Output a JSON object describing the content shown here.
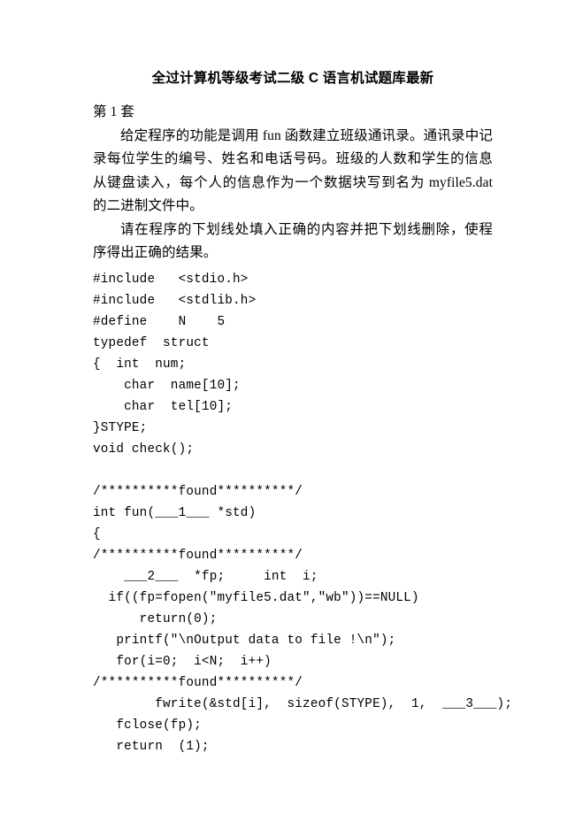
{
  "document": {
    "title": "全过计算机等级考试二级 C 语言机试题库最新",
    "section_label": "第 1 套",
    "paragraphs": [
      "给定程序的功能是调用 fun 函数建立班级通讯录。通讯录中记录每位学生的编号、姓名和电话号码。班级的人数和学生的信息从键盘读入，每个人的信息作为一个数据块写到名为 myfile5.dat 的二进制文件中。",
      "请在程序的下划线处填入正确的内容并把下划线删除，使程序得出正确的结果。"
    ],
    "code_lines": [
      "#include   <stdio.h>",
      "#include   <stdlib.h>",
      "#define    N    5",
      "typedef  struct",
      "{  int  num;",
      "    char  name[10];",
      "    char  tel[10];",
      "}STYPE;",
      "void check();",
      "",
      "/**********found**********/",
      "int fun(___1___ *std)",
      "{",
      "/**********found**********/",
      "    ___2___  *fp;     int  i;",
      "  if((fp=fopen(\"myfile5.dat\",\"wb\"))==NULL)",
      "      return(0);",
      "   printf(\"\\nOutput data to file !\\n\");",
      "   for(i=0;  i<N;  i++)",
      "/**********found**********/",
      "        fwrite(&std[i],  sizeof(STYPE),  1,  ___3___);",
      "   fclose(fp);",
      "   return  (1);"
    ]
  }
}
